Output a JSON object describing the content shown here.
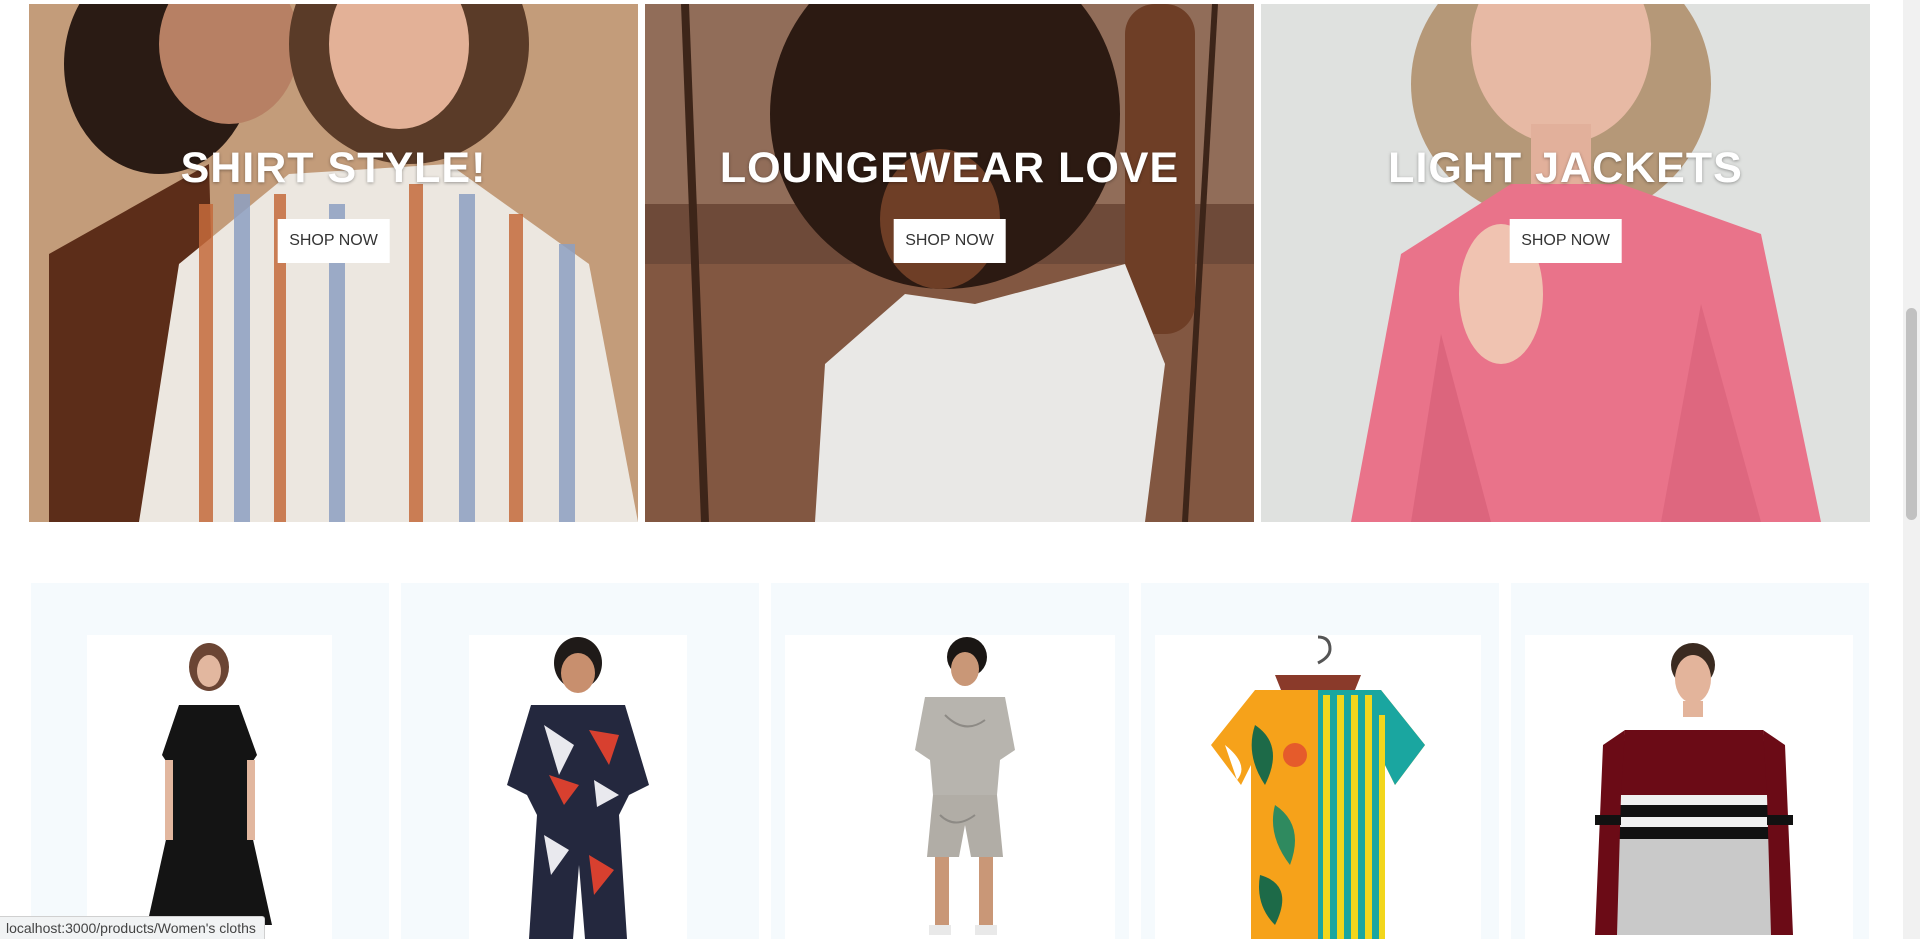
{
  "banners": [
    {
      "title": "SHIRT STYLE!",
      "button": "SHOP NOW"
    },
    {
      "title": "LOUNGEWEAR LOVE",
      "button": "SHOP NOW"
    },
    {
      "title": "LIGHT JACKETS",
      "button": "SHOP NOW"
    }
  ],
  "products": [
    {
      "name": "black-dress"
    },
    {
      "name": "printed-co-ord-set"
    },
    {
      "name": "grey-shorts-set"
    },
    {
      "name": "tropical-shirt"
    },
    {
      "name": "striped-tshirt"
    }
  ],
  "status_bar": {
    "url": "localhost:3000/products/Women's cloths"
  },
  "colors": {
    "card_bg": "#f5fafd",
    "banner1_bg": "#c9a584",
    "banner2_bg": "#6e4a39",
    "banner3_bg": "#dfe1df",
    "jacket_pink": "#e9738a"
  }
}
